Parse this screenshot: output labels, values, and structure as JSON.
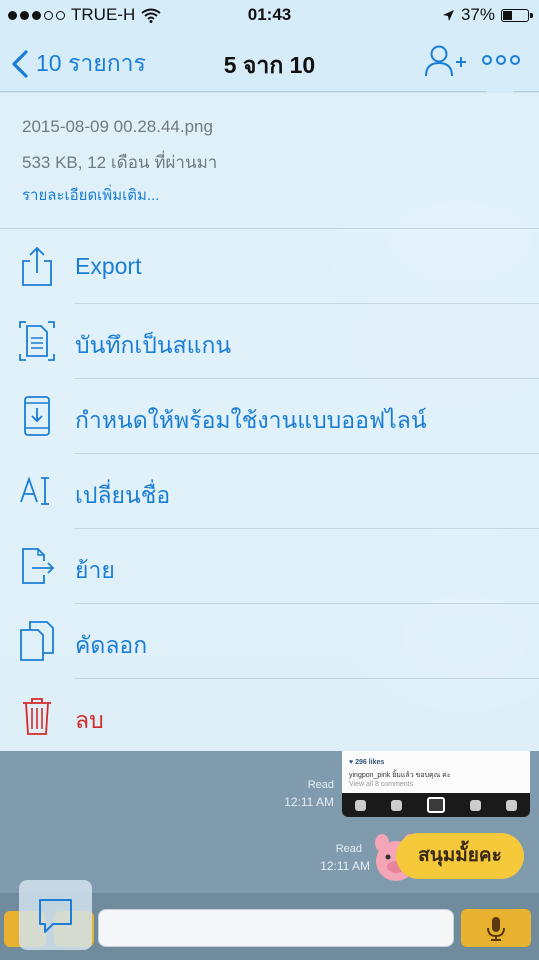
{
  "status_bar": {
    "carrier": "TRUE-H",
    "time": "01:43",
    "battery": "37%",
    "battery_level": 0.37
  },
  "nav": {
    "back_label": "10 รายการ",
    "title": "5 จาก 10"
  },
  "file_info": {
    "name": "2015-08-09 00.28.44.png",
    "meta": "533 KB, 12 เดือน ที่ผ่านมา",
    "more_details": "รายละเอียดเพิ่มเติม..."
  },
  "menu": {
    "items": [
      {
        "label": "Export",
        "icon": "share-icon"
      },
      {
        "label": "บันทึกเป็นสแกน",
        "icon": "scan-document-icon"
      },
      {
        "label": "กำหนดให้พร้อมใช้งานแบบออฟไลน์",
        "icon": "offline-device-icon"
      },
      {
        "label": "เปลี่ยนชื่อ",
        "icon": "rename-icon"
      },
      {
        "label": "ย้าย",
        "icon": "move-file-icon"
      },
      {
        "label": "คัดลอก",
        "icon": "copy-icon"
      },
      {
        "label": "ลบ",
        "icon": "trash-icon"
      }
    ]
  },
  "chat": {
    "msg1_read": "Read",
    "msg1_time": "12:11 AM",
    "msg2_read": "Read",
    "msg2_time": "12:11 AM",
    "thumbnail": {
      "likes": "♥ 296 likes",
      "caption": "yingpon_pink ยิ้มแล้ว ขอบคุณ ค่ะ",
      "view_comments": "View all 8 comments"
    },
    "sticker_text": "สนุมมั้ยคะ"
  },
  "colors": {
    "accent": "#1b7ed6",
    "danger": "#d62a2a",
    "sticker": "#f5c93a"
  }
}
